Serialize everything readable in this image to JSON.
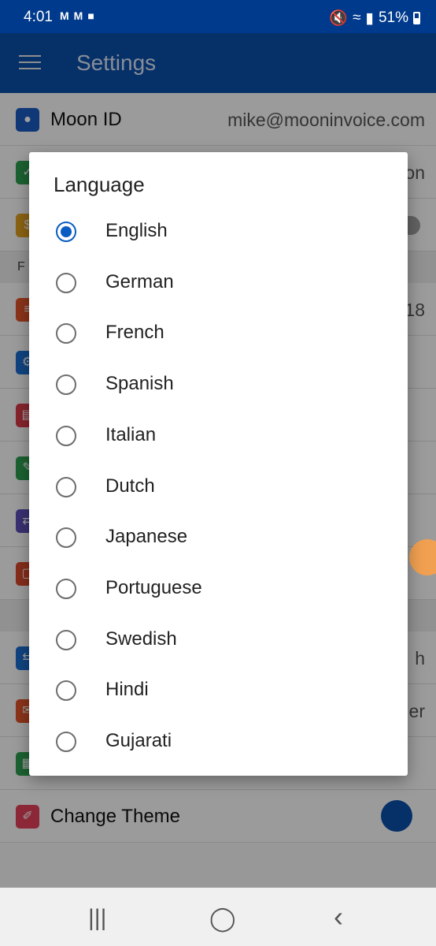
{
  "status": {
    "time": "4:01",
    "battery": "51%",
    "signal_icons": [
      "mute-icon",
      "wifi-icon",
      "signal-icon"
    ]
  },
  "appbar": {
    "title": "Settings"
  },
  "settings": {
    "moon_id": {
      "label": "Moon ID",
      "value": "mike@mooninvoice.com"
    },
    "row2_value_fragment": "on",
    "section_f": "F",
    "row4_value_fragment": "18",
    "row_h_value_fragment": "h",
    "row_er_value_fragment": "er",
    "change_theme": {
      "label": "Change Theme"
    }
  },
  "dialog": {
    "title": "Language",
    "selected": "English",
    "options": [
      "English",
      "German",
      "French",
      "Spanish",
      "Italian",
      "Dutch",
      "Japanese",
      "Portuguese",
      "Swedish",
      "Hindi",
      "Gujarati"
    ]
  },
  "nav": {
    "recents": "|||",
    "home": "◯",
    "back": "‹"
  },
  "colors": {
    "primary": "#0a4ea8",
    "statusbar": "#003a8c",
    "radio": "#0a5cc2"
  }
}
